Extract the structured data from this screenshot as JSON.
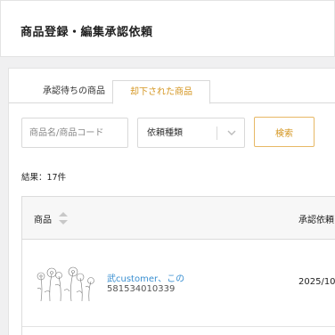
{
  "header": {
    "title": "商品登録・編集承認依頼"
  },
  "tabs": [
    {
      "label": "承認待ちの商品",
      "active": false
    },
    {
      "label": "却下された商品",
      "active": true
    }
  ],
  "filters": {
    "search_placeholder": "商品名/商品コード",
    "request_type_value": "依頼種類",
    "search_button_label": "検索"
  },
  "results": {
    "count_label": "結果：17件"
  },
  "table": {
    "columns": {
      "product": "商品",
      "request_date": "承認依頼"
    },
    "rows": [
      {
        "name": "武customer、この",
        "code": "581534010339",
        "date": "2025/10,"
      }
    ]
  },
  "colors": {
    "accent": "#d4951f",
    "link": "#3a8fd1",
    "border": "#d9d9d9"
  },
  "icons": {
    "sort": "sort-icon",
    "select": "chevron-down-icon",
    "thumbnail": "flower-illustration"
  }
}
